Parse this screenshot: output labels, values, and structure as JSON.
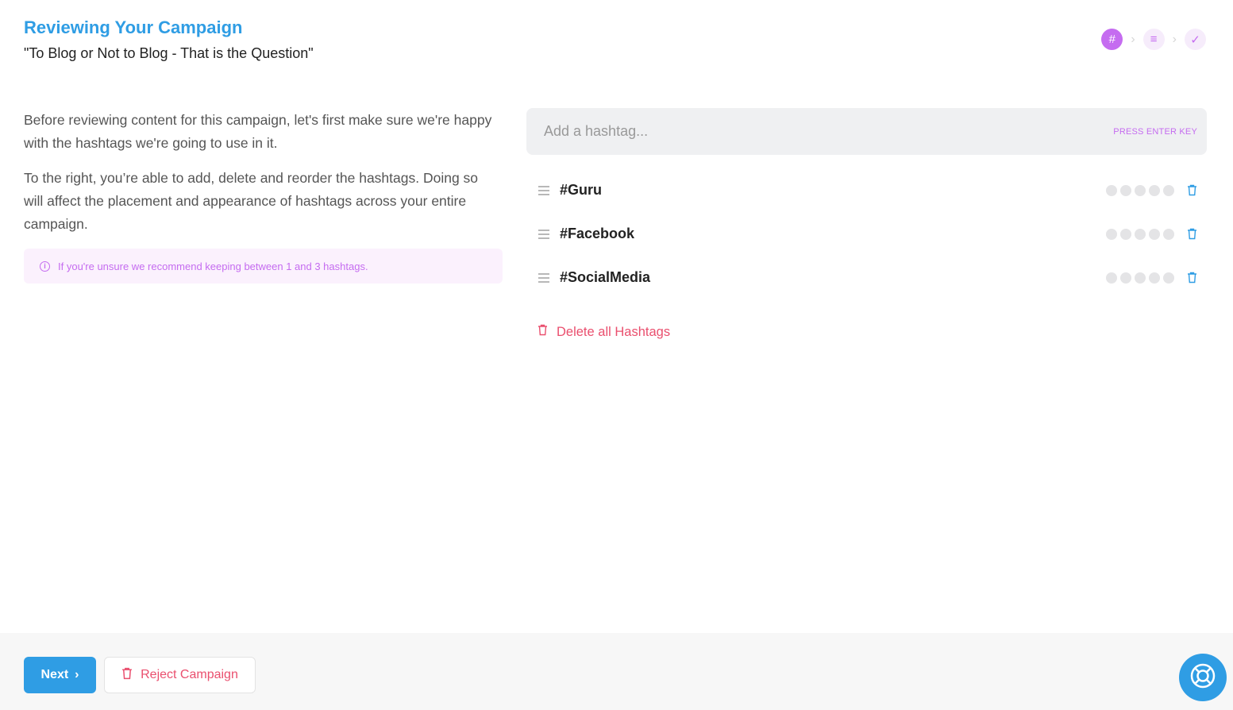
{
  "header": {
    "title": "Reviewing Your Campaign",
    "campaign_name": "\"To Blog or Not to Blog - That is the Question\""
  },
  "stepper": {
    "steps": [
      {
        "icon": "hashtag-icon",
        "symbol": "#",
        "state": "active"
      },
      {
        "icon": "content-lines-icon",
        "symbol": "≡",
        "state": "inactive"
      },
      {
        "icon": "checkmark-icon",
        "symbol": "✓",
        "state": "inactive"
      }
    ]
  },
  "intro": {
    "paragraph1": "Before reviewing content for this campaign, let's first make sure we're happy with the hashtags we're going to use in it.",
    "paragraph2": "To the right, you’re able to add, delete and reorder the hashtags. Doing so will affect the placement and appearance of hashtags across your entire campaign.",
    "tip": "If you're unsure we recommend keeping between 1 and 3 hashtags."
  },
  "hashtag_input": {
    "placeholder": "Add a hashtag...",
    "value": "",
    "hint": "PRESS ENTER KEY"
  },
  "hashtags": [
    {
      "name": "#Guru",
      "rating": 0,
      "rating_max": 5
    },
    {
      "name": "#Facebook",
      "rating": 0,
      "rating_max": 5
    },
    {
      "name": "#SocialMedia",
      "rating": 0,
      "rating_max": 5
    }
  ],
  "delete_all_label": "Delete all Hashtags",
  "footer": {
    "next_label": "Next",
    "reject_label": "Reject Campaign"
  },
  "colors": {
    "accent_blue": "#2f9de4",
    "accent_purple": "#c56cf0",
    "danger": "#ea4f6e"
  }
}
